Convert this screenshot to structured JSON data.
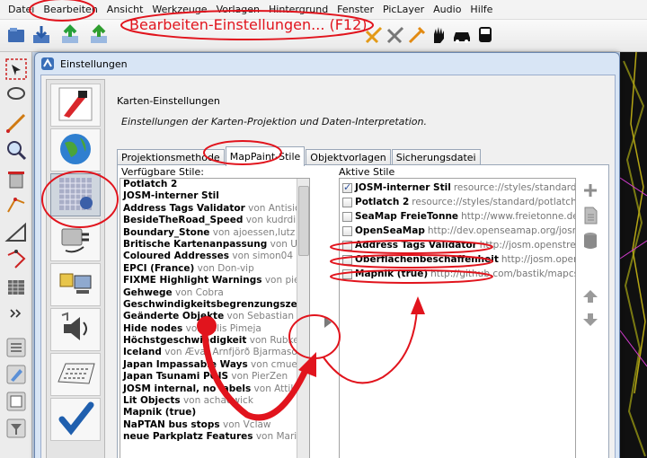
{
  "menubar": {
    "items": [
      "Datei",
      "Bearbeiten",
      "Ansicht",
      "Werkzeuge",
      "Vorlagen",
      "Hintergrund",
      "Fenster",
      "PicLayer",
      "Audio",
      "Hilfe"
    ]
  },
  "annotation": {
    "text": "Bearbeiten-Einstellungen... (F12)",
    "color": "#e1141d"
  },
  "dialog": {
    "title": "Einstellungen",
    "pane_title": "Karten-Einstellungen",
    "pane_description": "Einstellungen der Karten-Projektion und Daten-Interpretation.",
    "tabs": [
      "Projektionsmethode",
      "MapPaint-Stile",
      "Objektvorlagen",
      "Sicherungsdatei"
    ],
    "active_tab": "MapPaint-Stile",
    "available_label": "Verfügbare Stile:",
    "active_label": "Aktive Stile",
    "available_styles": [
      {
        "name": "Potlatch 2",
        "by": ""
      },
      {
        "name": "JOSM-interner Stil",
        "by": ""
      },
      {
        "name": "Address Tags Validator",
        "by": " von Antisida"
      },
      {
        "name": "BesideTheRoad_Speed",
        "by": " von kudrdim"
      },
      {
        "name": "Boundary_Stone",
        "by": " von ajoessen,lutz"
      },
      {
        "name": "Britische Kartenanpassung",
        "by": " von Ulf"
      },
      {
        "name": "Coloured Addresses",
        "by": " von simon04"
      },
      {
        "name": "EPCI (France)",
        "by": " von Don-vip"
      },
      {
        "name": "FIXME Highlight Warnings",
        "by": " von pierz"
      },
      {
        "name": "Gehwege",
        "by": " von Cobra"
      },
      {
        "name": "Geschwindigkeitsbegrenzungszei",
        "by": ""
      },
      {
        "name": "Geänderte Objekte",
        "by": " von Sebastian K"
      },
      {
        "name": "Hide nodes",
        "by": " von Felis Pimeja"
      },
      {
        "name": "Höchstgeschwindigkeit",
        "by": " von Rubke,"
      },
      {
        "name": "Iceland",
        "by": " von Ævar Arnfjörð Bjarmason"
      },
      {
        "name": "Japan Impassable Ways",
        "by": " von cmuel"
      },
      {
        "name": "Japan Tsunami POIS",
        "by": " von PierZen"
      },
      {
        "name": "JOSM internal, no labels",
        "by": " von Attil"
      },
      {
        "name": "Lit Objects",
        "by": " von achadwick"
      },
      {
        "name": "Mapnik (true)",
        "by": ""
      },
      {
        "name": "NaPTAN bus stops",
        "by": " von Vclaw"
      },
      {
        "name": "neue Parkplatz Features",
        "by": " von Mario"
      }
    ],
    "active_styles": [
      {
        "name": "JOSM-interner Stil",
        "src": "resource://styles/standard/e",
        "checked": true
      },
      {
        "name": "Potlatch 2",
        "src": "resource://styles/standard/potlatch2.",
        "checked": false
      },
      {
        "name": "SeaMap FreieTonne",
        "src": "http://www.freietonne.de",
        "checked": false
      },
      {
        "name": "OpenSeaMap",
        "src": "http://dev.openseamap.org/josm/",
        "checked": false
      },
      {
        "name": "Address Tags Validator",
        "src": "http://josm.openstree",
        "checked": false
      },
      {
        "name": "Oberflächenbeschaffenheit",
        "src": "http://josm.opens",
        "checked": false
      },
      {
        "name": "Mapnik (true)",
        "src": "http://github.com/bastik/mapcss-",
        "checked": false
      }
    ],
    "move_right_icon": "triangle-right-icon",
    "side_icons": [
      "plus-icon",
      "document-icon",
      "delete-icon",
      "arrow-up-icon",
      "arrow-down-icon"
    ],
    "categories": [
      "display-settings-icon",
      "globe-icon",
      "map-grid-icon",
      "plugin-icon",
      "connection-icon",
      "audio-icon",
      "keyboard-icon",
      "checkmark-icon"
    ]
  }
}
